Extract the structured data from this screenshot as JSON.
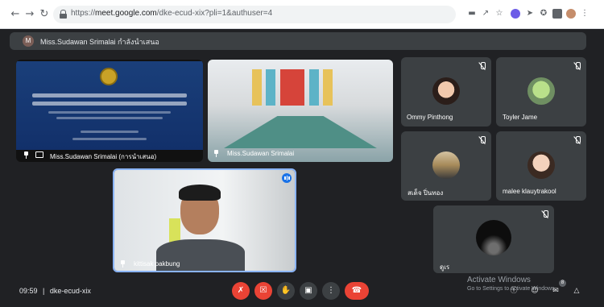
{
  "browser": {
    "url_prefix": "https://",
    "url_host": "meet.google.com",
    "url_rest": "/dke-ecud-xix?pli=1&authuser=4"
  },
  "header": {
    "avatar_letter": "M",
    "text": "Miss.Sudawan Srimalai กำลังนำเสนอ"
  },
  "tiles": {
    "presentation": {
      "name": "Miss.Sudawan Srimalai (การนำเสนอ)"
    },
    "camera_room": {
      "name": "Miss.Sudawan Srimalai"
    },
    "speaker": {
      "name": "kittisak pakbung"
    },
    "ommy": {
      "name": "Ommy Pinthong"
    },
    "toyler": {
      "name": "Toyler Jame"
    },
    "sadet": {
      "name": "สเด็จ ปิ่นทอง"
    },
    "malee": {
      "name": "malee klauytrakool"
    },
    "unknown": {
      "name": "ดูเร"
    }
  },
  "bottom_bar": {
    "time": "09:59",
    "separator": "|",
    "meeting_code": "dke-ecud-xix",
    "participants_badge": "8"
  },
  "watermark": {
    "title": "Activate Windows",
    "subtitle": "Go to Settings to activate Windows."
  },
  "colors": {
    "background": "#202124",
    "tile": "#3c4043",
    "active_speaker_border": "#8ab4f8",
    "danger": "#ea4335",
    "slide_blue": "#1a3f7a"
  }
}
